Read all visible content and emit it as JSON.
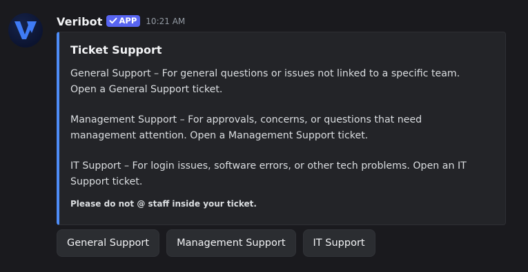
{
  "author": {
    "name": "Veribot",
    "badge": "APP",
    "timestamp": "10:21 AM",
    "avatar_icon": "veribot-v-logo"
  },
  "embed": {
    "accent_color": "#4e8cf7",
    "title": "Ticket Support",
    "paragraphs": [
      "General Support – For general questions or issues not linked to a specific team.\nOpen a General Support ticket.",
      "Management Support – For approvals, concerns, or questions that need\nmanagement attention. Open a Management Support ticket.",
      "IT Support – For login issues, software errors, or other tech problems. Open an IT\nSupport ticket."
    ],
    "footer": "Please do not @ staff inside your ticket."
  },
  "buttons": {
    "general": "General Support",
    "management": "Management Support",
    "it": "IT Support"
  },
  "colors": {
    "background": "#1a1a1e",
    "embed_background": "#232428",
    "badge": "#5865f2",
    "button": "#2b2d31"
  }
}
